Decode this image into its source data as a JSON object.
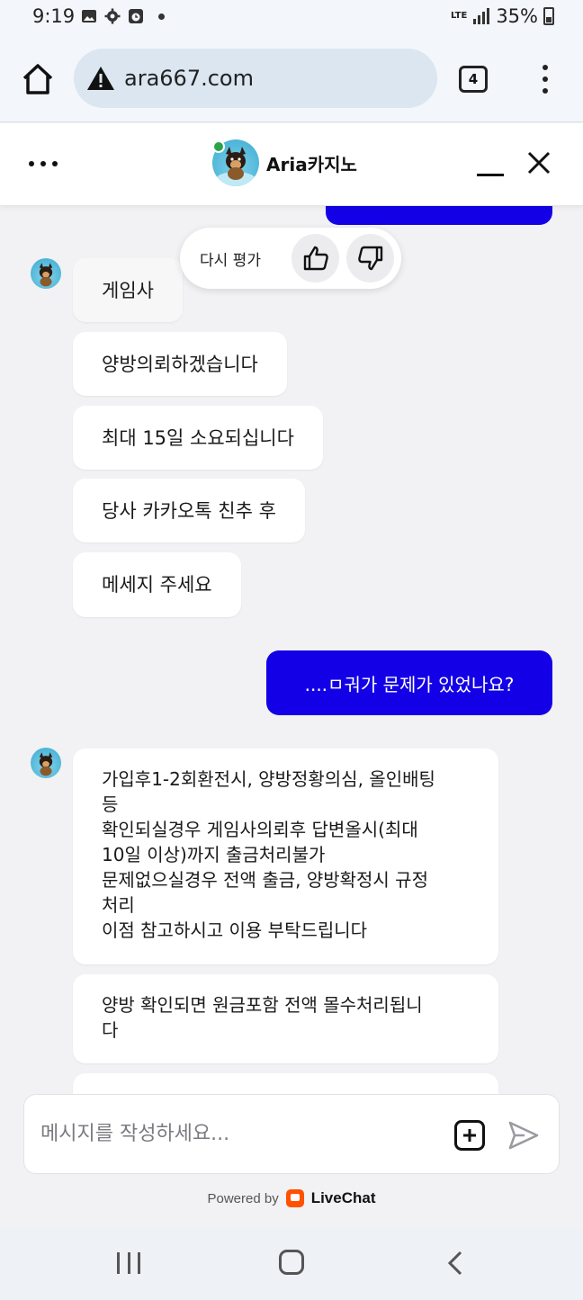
{
  "status_bar": {
    "time": "9:19",
    "network": "LTE",
    "battery": "35%",
    "icons": [
      "image-icon",
      "gear-icon",
      "clock-icon",
      "dot-icon",
      "signal-icon",
      "battery-icon"
    ]
  },
  "browser": {
    "url": "ara667.com",
    "tab_count": "4",
    "icons": [
      "home-icon",
      "warning-icon",
      "tabs-icon",
      "kebab-menu-icon"
    ]
  },
  "chat_header": {
    "title": "Aria카지노",
    "icons": [
      "more-icon",
      "minimize-icon",
      "close-icon"
    ]
  },
  "rating": {
    "label": "다시 평가",
    "icons": [
      "thumbs-up-icon",
      "thumbs-down-icon"
    ]
  },
  "messages": {
    "agent_group_1": [
      "게임사",
      "양방의뢰하겠습니다",
      "최대 15일 소요되십니다",
      "당사 카카오톡 친추 후",
      "메세지 주세요"
    ],
    "user_message": "....ㅁ궈가 문제가 있었나요?",
    "agent_group_2": [
      "가입후1-2회환전시, 양방정황의심, 올인배팅\n등\n확인되실경우 게임사의뢰후 답변올시(최대\n10일 이상)까지 출금처리불가\n문제없으실경우 전액 출금, 양방확정시 규정\n처리\n이점 참고하시고 이용 부탁드립니다",
      "양방 확인되면 원금포함 전액 몰수처리됩니\n다"
    ]
  },
  "composer": {
    "placeholder": "메시지를 작성하세요...",
    "value": "",
    "powered_by": "Powered by",
    "brand": "LiveChat"
  },
  "colors": {
    "user_bubble": "#1400e6",
    "agent_bubble": "#ffffff",
    "background": "#f2f2f4",
    "livechat_orange": "#ff5100"
  },
  "nav": {
    "icons": [
      "recent-apps-icon",
      "home-nav-icon",
      "back-icon"
    ]
  }
}
